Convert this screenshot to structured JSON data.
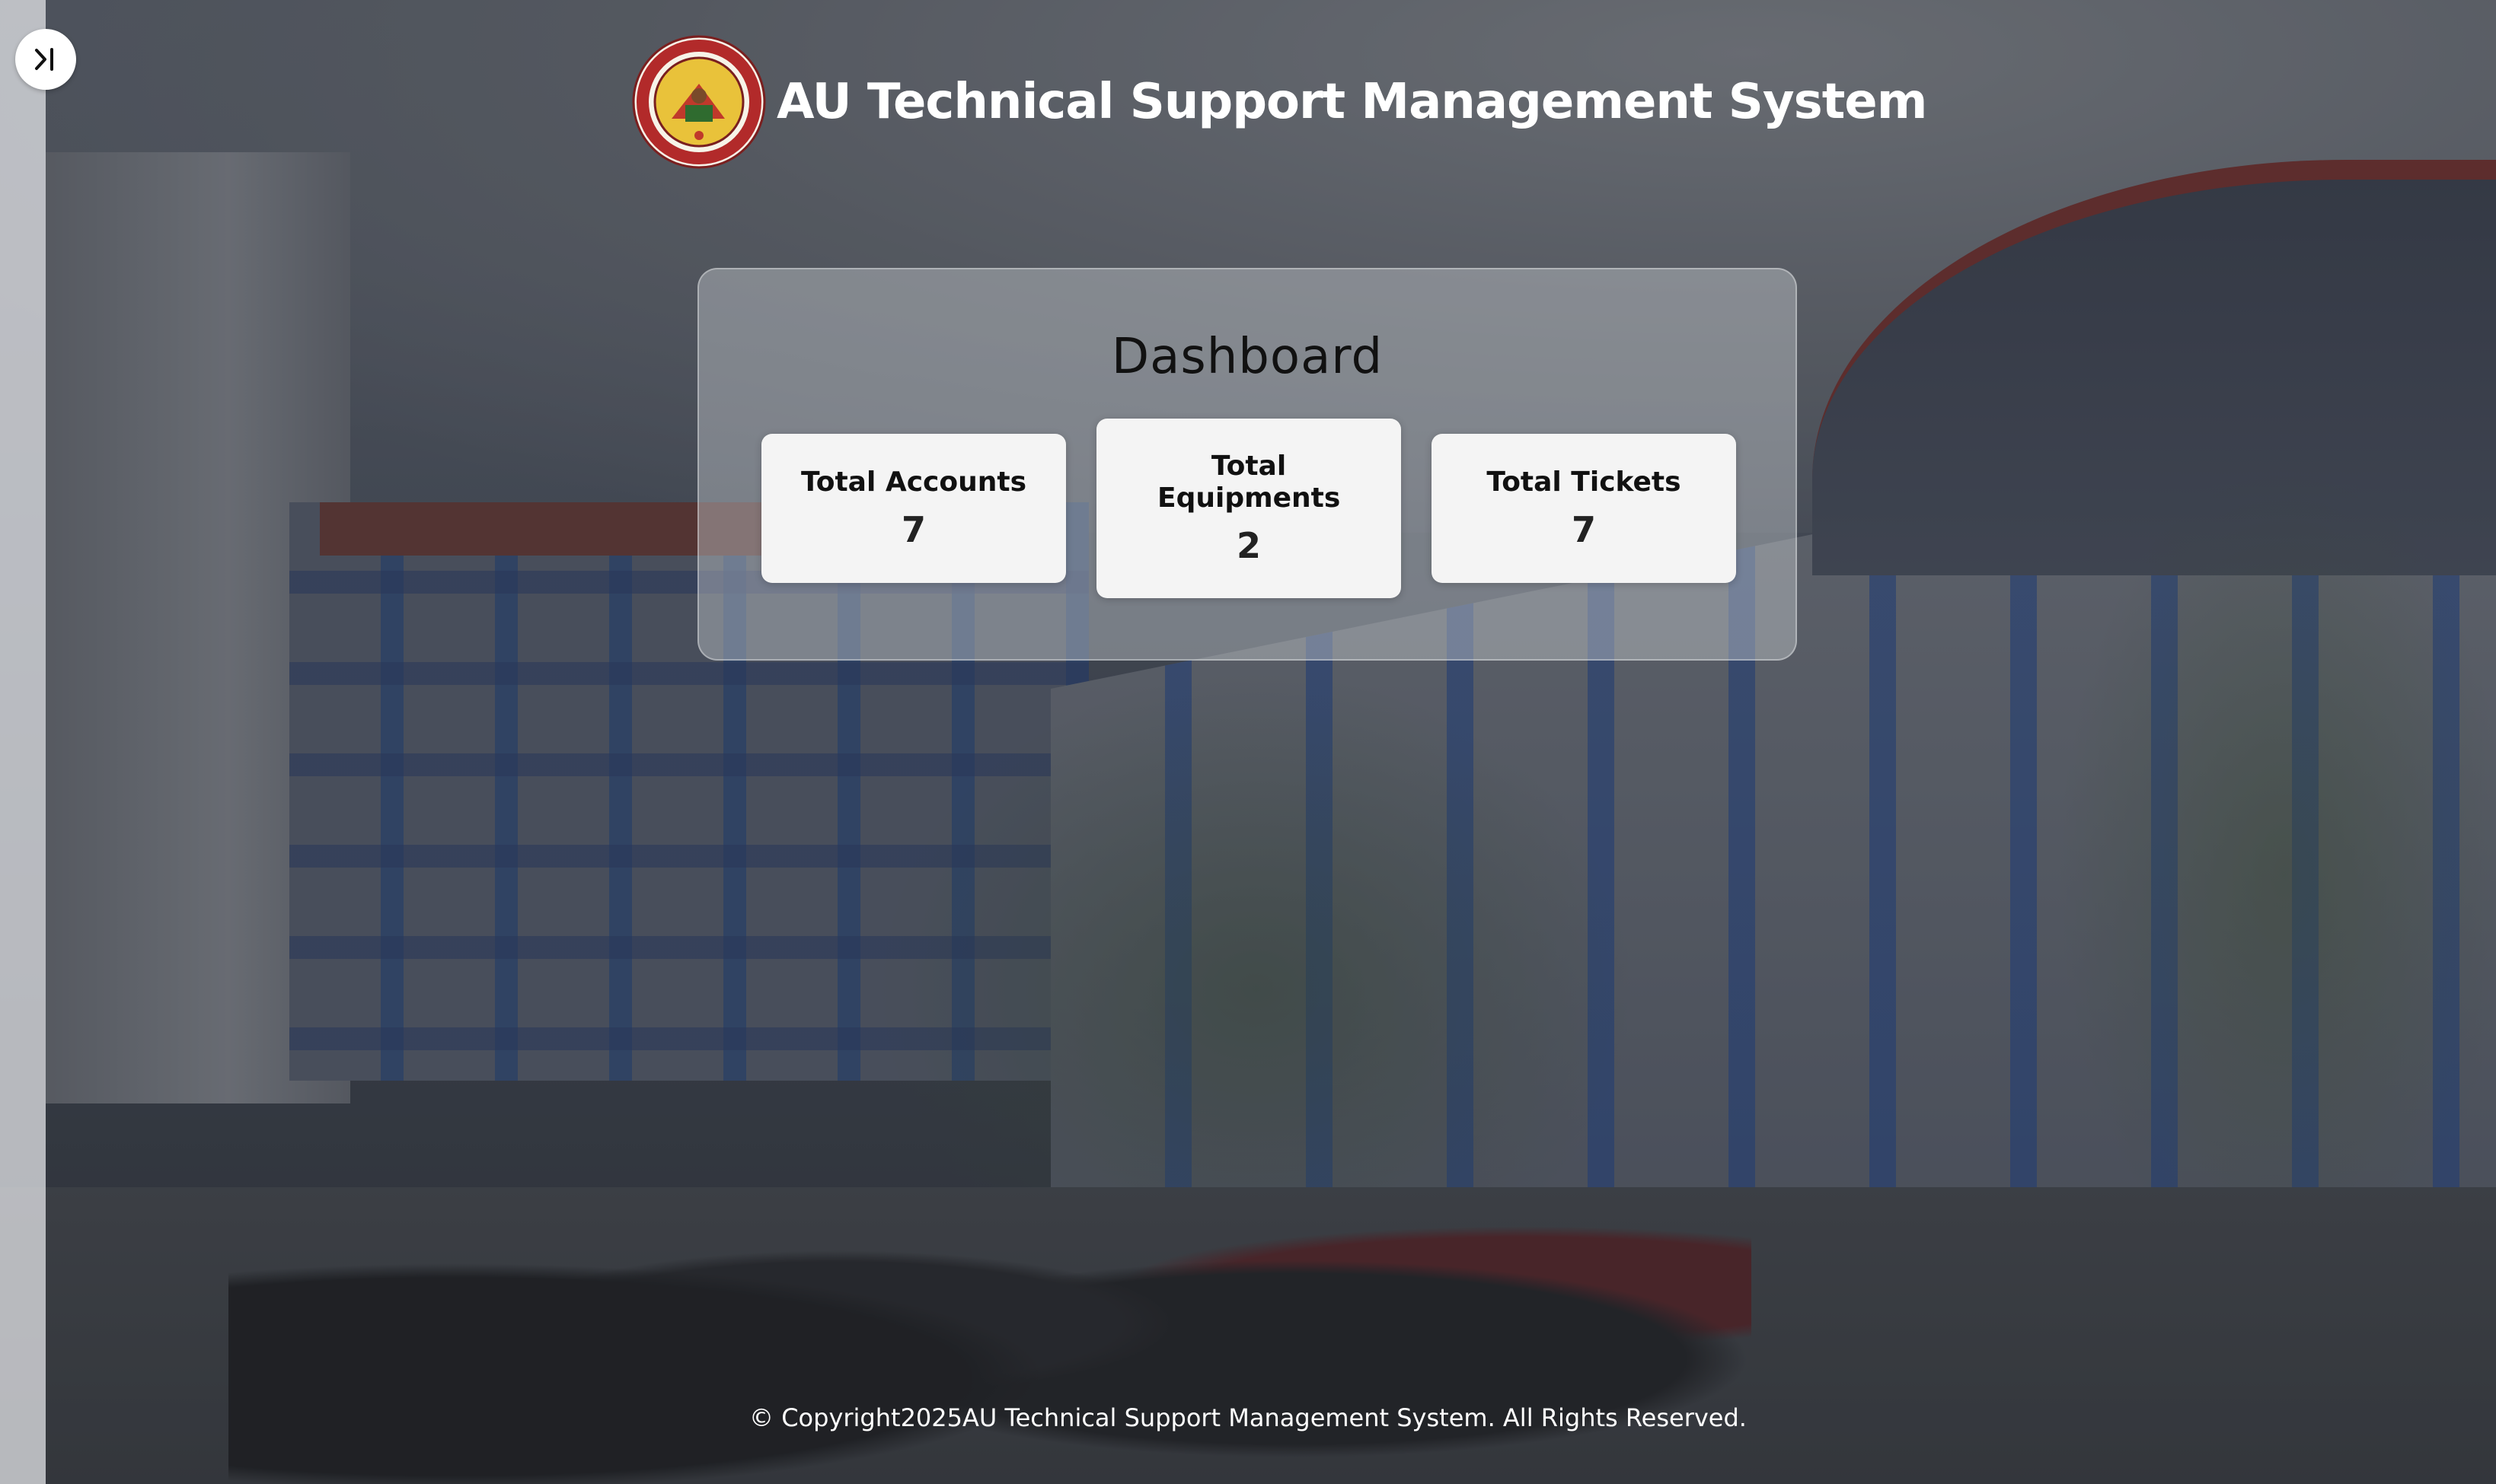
{
  "header": {
    "app_title": "AU Technical Support Management System",
    "logo_icon": "arellano-university-seal-icon"
  },
  "sidebar": {
    "toggle_icon": "expand-sidebar-icon"
  },
  "dashboard": {
    "title": "Dashboard",
    "cards": [
      {
        "label": "Total Accounts",
        "value": "7"
      },
      {
        "label": "Total Equipments",
        "value": "2"
      },
      {
        "label": "Total Tickets",
        "value": "7"
      }
    ]
  },
  "footer": {
    "copyright": "© Copyright2025AU Technical Support Management System. All Rights Reserved."
  },
  "colors": {
    "title_text": "#ffffff",
    "card_background": "#f4f4f4",
    "panel_background": "rgba(200,204,210,0.42)"
  }
}
